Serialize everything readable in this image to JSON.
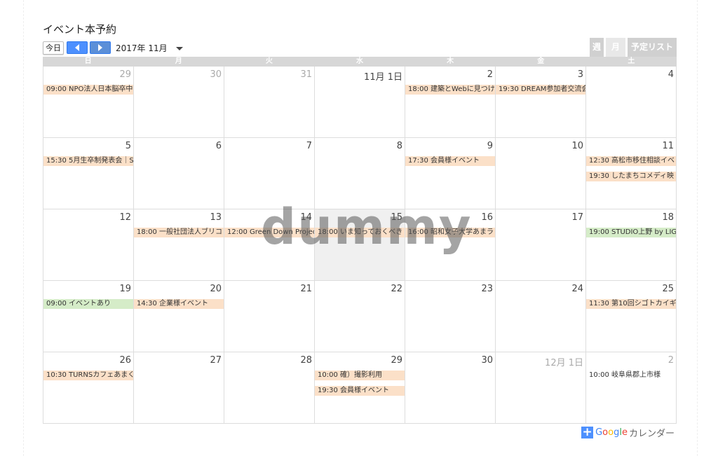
{
  "title": "イベント本予約",
  "toolbar": {
    "today_label": "今日",
    "date_label": "2017年 11月"
  },
  "view_tabs": {
    "week": "週",
    "month": "月",
    "list": "予定リスト"
  },
  "weekdays": [
    "日",
    "月",
    "火",
    "水",
    "木",
    "金",
    "土"
  ],
  "weeks": [
    {
      "days": [
        {
          "num": "29",
          "other": true,
          "events": [
            {
              "text": "09:00 NPO法人日本脳卒中",
              "color": "orange"
            }
          ]
        },
        {
          "num": "30",
          "other": true,
          "events": []
        },
        {
          "num": "31",
          "other": true,
          "events": []
        },
        {
          "num": "11月 1日",
          "other": false,
          "events": []
        },
        {
          "num": "2",
          "other": false,
          "events": [
            {
              "text": "18:00 建築とWebに見つけ",
              "color": "orange"
            }
          ]
        },
        {
          "num": "3",
          "other": false,
          "events": [
            {
              "text": "19:30 DREAM参加者交流会",
              "color": "orange"
            }
          ]
        },
        {
          "num": "4",
          "other": false,
          "events": []
        }
      ]
    },
    {
      "days": [
        {
          "num": "5",
          "other": false,
          "events": [
            {
              "text": "15:30 5月生卒制発表会｜S",
              "color": "orange"
            }
          ]
        },
        {
          "num": "6",
          "other": false,
          "events": []
        },
        {
          "num": "7",
          "other": false,
          "events": []
        },
        {
          "num": "8",
          "other": false,
          "events": []
        },
        {
          "num": "9",
          "other": false,
          "events": [
            {
              "text": "17:30 会員様イベント",
              "color": "orange"
            }
          ]
        },
        {
          "num": "10",
          "other": false,
          "events": []
        },
        {
          "num": "11",
          "other": false,
          "events": [
            {
              "text": "12:30 高松市移住相談イベ",
              "color": "orange"
            },
            {
              "text": "19:30 したまちコメディ映",
              "color": "orange"
            }
          ]
        }
      ]
    },
    {
      "days": [
        {
          "num": "12",
          "other": false,
          "events": []
        },
        {
          "num": "13",
          "other": false,
          "events": [
            {
              "text": "18:00 一般社団法人ブリコ",
              "color": "orange"
            }
          ]
        },
        {
          "num": "14",
          "other": false,
          "events": [
            {
              "text": "12:00 Green Down Project",
              "color": "orange"
            }
          ]
        },
        {
          "num": "15",
          "other": false,
          "today": true,
          "events": [
            {
              "text": "18:00 いま知っておくべき",
              "color": "orange"
            }
          ]
        },
        {
          "num": "16",
          "other": false,
          "events": [
            {
              "text": "16:00 昭和女子大学あまラ",
              "color": "orange"
            }
          ]
        },
        {
          "num": "17",
          "other": false,
          "events": []
        },
        {
          "num": "18",
          "other": false,
          "events": [
            {
              "text": "19:00 STUDIO上野 by LIG",
              "color": "green"
            }
          ]
        }
      ]
    },
    {
      "days": [
        {
          "num": "19",
          "other": false,
          "events": [
            {
              "text": "09:00 イベントあり",
              "color": "green"
            }
          ]
        },
        {
          "num": "20",
          "other": false,
          "events": [
            {
              "text": "14:30 企業様イベント",
              "color": "orange"
            }
          ]
        },
        {
          "num": "21",
          "other": false,
          "events": []
        },
        {
          "num": "22",
          "other": false,
          "events": []
        },
        {
          "num": "23",
          "other": false,
          "events": []
        },
        {
          "num": "24",
          "other": false,
          "events": []
        },
        {
          "num": "25",
          "other": false,
          "events": [
            {
              "text": "11:30 第10回シゴトカイギ",
              "color": "orange"
            }
          ]
        }
      ]
    },
    {
      "days": [
        {
          "num": "26",
          "other": false,
          "events": [
            {
              "text": "10:30 TURNSカフェあまく",
              "color": "orange"
            }
          ]
        },
        {
          "num": "27",
          "other": false,
          "events": []
        },
        {
          "num": "28",
          "other": false,
          "events": []
        },
        {
          "num": "29",
          "other": false,
          "events": [
            {
              "text": "10:00 確）撮影利用",
              "color": "orange"
            },
            {
              "text": "19:30 会員様イベント",
              "color": "orange"
            }
          ]
        },
        {
          "num": "30",
          "other": false,
          "events": []
        },
        {
          "num": "12月 1日",
          "other": true,
          "events": []
        },
        {
          "num": "2",
          "other": true,
          "events": [
            {
              "text": "10:00 岐阜県郡上市様",
              "color": "plain"
            }
          ]
        }
      ]
    }
  ],
  "watermark": "dummy",
  "footer": {
    "google": "Google",
    "calendar": "カレンダー"
  },
  "colors": {
    "orange_event": "#fbe0c8",
    "green_event": "#d5ecc8",
    "nav_blue": "#4d90fe",
    "google_blue": "#4285f4",
    "google_red": "#ea4335",
    "google_yellow": "#fbbc05",
    "google_green": "#34a853"
  }
}
